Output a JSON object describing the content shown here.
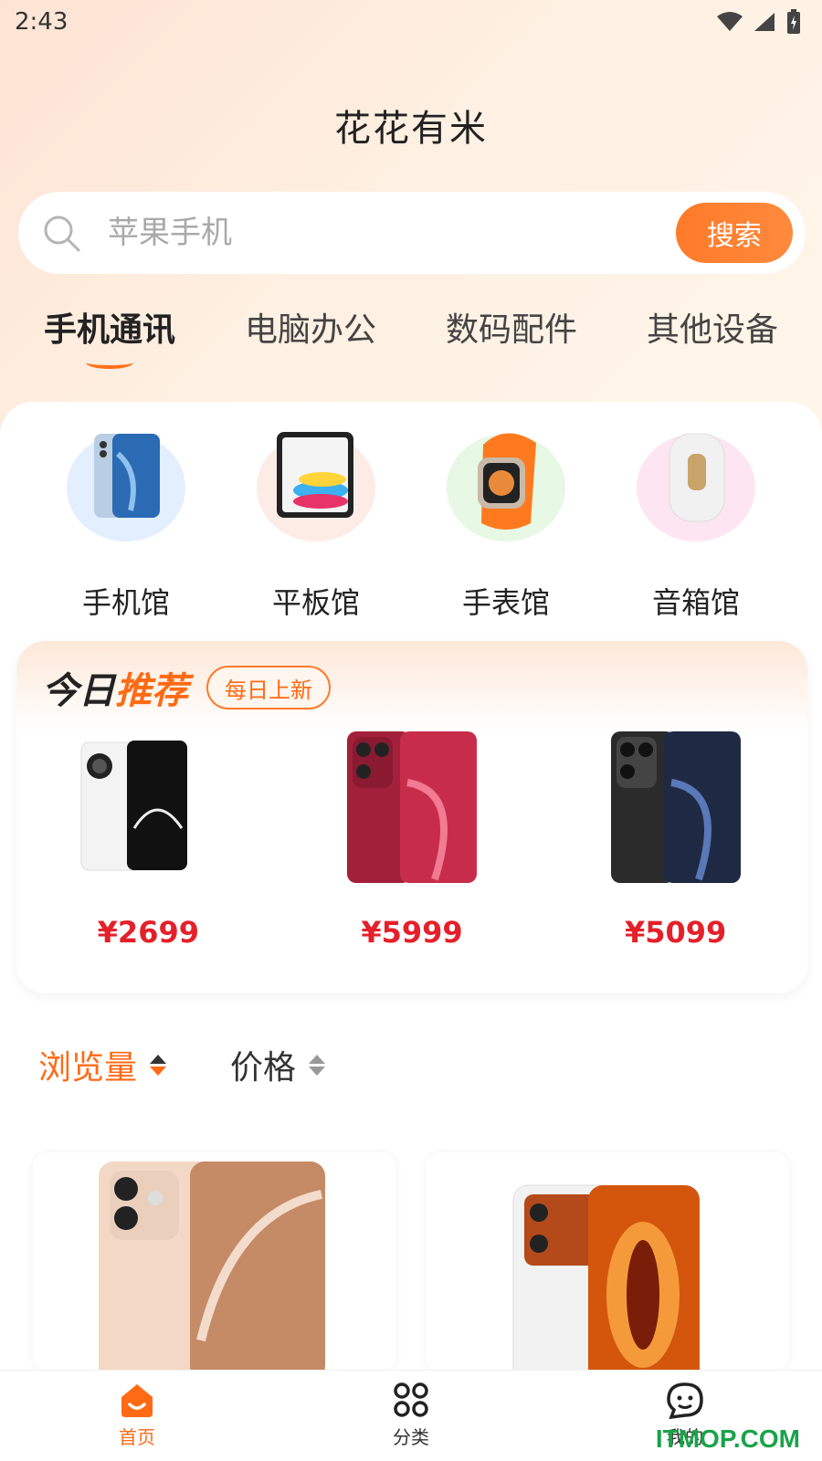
{
  "status_bar": {
    "time": "2:43"
  },
  "app": {
    "title": "花花有米"
  },
  "search": {
    "placeholder": "苹果手机",
    "button_label": "搜索"
  },
  "tabs": [
    {
      "label": "手机通讯",
      "active": true
    },
    {
      "label": "电脑办公",
      "active": false
    },
    {
      "label": "数码配件",
      "active": false
    },
    {
      "label": "其他设备",
      "active": false
    }
  ],
  "venues": [
    {
      "label": "手机馆",
      "icon": "phone-image"
    },
    {
      "label": "平板馆",
      "icon": "tablet-image"
    },
    {
      "label": "手表馆",
      "icon": "watch-image"
    },
    {
      "label": "音箱馆",
      "icon": "speaker-image"
    }
  ],
  "recommend": {
    "title_part1": "今日",
    "title_part2": "推荐",
    "tag": "每日上新",
    "items": [
      {
        "price": "¥2699",
        "image": "white-phone-image"
      },
      {
        "price": "¥5999",
        "image": "red-phone-image"
      },
      {
        "price": "¥5099",
        "image": "black-phone-image"
      }
    ]
  },
  "sort": [
    {
      "label": "浏览量",
      "active": true
    },
    {
      "label": "价格",
      "active": false
    }
  ],
  "bottom_nav": [
    {
      "label": "首页",
      "icon": "home-icon",
      "active": true
    },
    {
      "label": "分类",
      "icon": "category-icon",
      "active": false
    },
    {
      "label": "我的",
      "icon": "profile-icon",
      "active": false
    }
  ],
  "watermark": "ITMOP.COM",
  "colors": {
    "accent": "#ff6a14",
    "price": "#e4202a"
  }
}
